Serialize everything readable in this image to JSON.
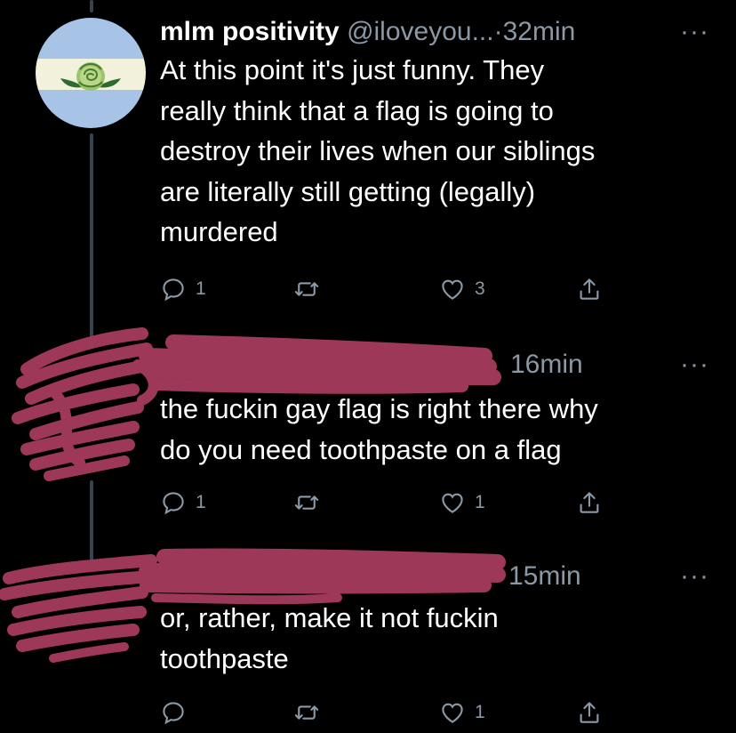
{
  "tweets": [
    {
      "name": "mlm positivity",
      "handle": "@iloveyou...",
      "dot": "·",
      "time": "32min",
      "more": "···",
      "lines": [
        "At this point it's just funny. They",
        "really think that a flag is going to",
        "destroy their lives when our siblings",
        "are literally still getting (legally)",
        "murdered"
      ],
      "replies": "1",
      "likes": "3"
    },
    {
      "time": "16min",
      "more": "···",
      "lines": [
        "the fuckin gay flag is right there why",
        "do you need toothpaste on a flag"
      ],
      "replies": "1",
      "likes": "1"
    },
    {
      "time": "15min",
      "more": "···",
      "lines": [
        "or, rather, make it not fuckin",
        "toothpaste"
      ],
      "likes": "1"
    }
  ],
  "icons": {
    "reply": "reply-icon",
    "retweet": "retweet-icon",
    "like": "heart-icon",
    "share": "share-icon"
  },
  "colors": {
    "background": "#000000",
    "text": "#ffffff",
    "secondary": "#8b98a5",
    "redaction": "#a43a5c",
    "thread_line": "#38444d"
  }
}
